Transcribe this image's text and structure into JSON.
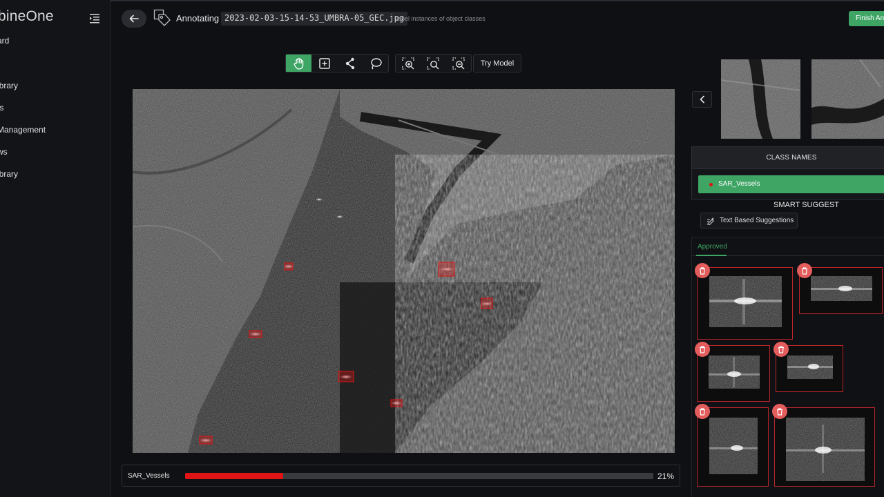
{
  "app": {
    "brand": "bineOne"
  },
  "sidebar": {
    "items": [
      {
        "label": "ard"
      },
      {
        "label": "ibrary"
      },
      {
        "label": "ts"
      },
      {
        "label": "Management"
      },
      {
        "label": "ws"
      },
      {
        "label": "ibrary"
      }
    ]
  },
  "header": {
    "annotating_label": "Annotating",
    "filename": "2023-02-03-15-14-53_UMBRA-05_GEC.jpg",
    "subtitle": "label instances of object classes",
    "finish_button": "Finish An"
  },
  "toolbar": {
    "tools": [
      {
        "name": "pan-hand",
        "active": true
      },
      {
        "name": "bounding-box",
        "active": false
      },
      {
        "name": "polygon",
        "active": false
      },
      {
        "name": "lasso",
        "active": false
      }
    ],
    "zoom_tools": [
      "zoom-in",
      "zoom-fit",
      "zoom-out"
    ],
    "try_model": "Try Model"
  },
  "progress": {
    "label": "SAR_Vessels",
    "percent_text": "21%",
    "fraction": 0.21,
    "color": "#e01414"
  },
  "right_panel": {
    "class_names_title": "CLASS NAMES",
    "classes": [
      {
        "name": "SAR_Vessels",
        "color": "#e01414"
      }
    ],
    "smart_suggest_title": "SMART SUGGEST",
    "text_suggestions_button": "Text Based Suggestions",
    "approved_tab": "Approved"
  },
  "colors": {
    "accent_green": "#3fa565",
    "annotation_red": "#e01414",
    "card_border": "#b8252a",
    "trash_bg": "#e35d5d"
  }
}
